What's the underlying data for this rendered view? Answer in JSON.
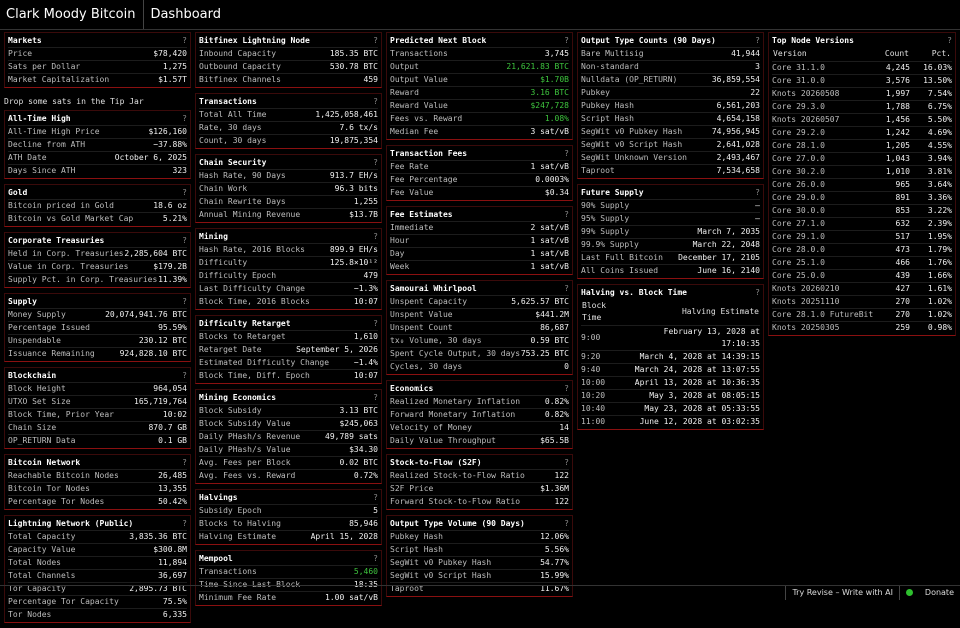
{
  "header": {
    "title": "Clark Moody Bitcoin",
    "tab": "Dashboard"
  },
  "col1": [
    {
      "name": "markets",
      "title": "Markets",
      "rows": [
        [
          "Price",
          "$78,420"
        ],
        [
          "Sats per Dollar",
          "1,275"
        ],
        [
          "Market Capitalization",
          "$1.57T"
        ]
      ]
    },
    {
      "name": "tip-jar",
      "plain": "Drop some sats in the Tip Jar"
    },
    {
      "name": "all-time-high",
      "title": "All-Time High",
      "rows": [
        [
          "All-Time High Price",
          "$126,160"
        ],
        [
          "Decline from ATH",
          "−37.88%"
        ],
        [
          "ATH Date",
          "October 6, 2025"
        ],
        [
          "Days Since ATH",
          "323"
        ]
      ]
    },
    {
      "name": "gold",
      "title": "Gold",
      "rows": [
        [
          "Bitcoin priced in Gold",
          "18.6 oz"
        ],
        [
          "Bitcoin vs Gold Market Cap",
          "5.21%"
        ]
      ]
    },
    {
      "name": "corporate-treasuries",
      "title": "Corporate Treasuries",
      "rows": [
        [
          "Held in Corp. Treasuries",
          "2,285,604 BTC"
        ],
        [
          "Value in Corp. Treasuries",
          "$179.2B"
        ],
        [
          "Supply Pct. in Corp. Treasuries",
          "11.39%"
        ]
      ]
    },
    {
      "name": "supply",
      "title": "Supply",
      "rows": [
        [
          "Money Supply",
          "20,074,941.76 BTC"
        ],
        [
          "Percentage Issued",
          "95.59%"
        ],
        [
          "Unspendable",
          "230.12 BTC"
        ],
        [
          "Issuance Remaining",
          "924,828.10 BTC"
        ]
      ]
    },
    {
      "name": "blockchain",
      "title": "Blockchain",
      "rows": [
        [
          "Block Height",
          "964,054"
        ],
        [
          "UTXO Set Size",
          "165,719,764"
        ],
        [
          "Block Time, Prior Year",
          "10:02"
        ],
        [
          "Chain Size",
          "870.7 GB"
        ],
        [
          "OP_RETURN Data",
          "0.1 GB"
        ]
      ]
    },
    {
      "name": "bitcoin-network",
      "title": "Bitcoin Network",
      "rows": [
        [
          "Reachable Bitcoin Nodes",
          "26,485"
        ],
        [
          "Bitcoin Tor Nodes",
          "13,355"
        ],
        [
          "Percentage Tor Nodes",
          "50.42%"
        ]
      ]
    },
    {
      "name": "lightning-network",
      "title": "Lightning Network (Public)",
      "rows": [
        [
          "Total Capacity",
          "3,835.36 BTC"
        ],
        [
          "Capacity Value",
          "$300.8M"
        ],
        [
          "Total Nodes",
          "11,894"
        ],
        [
          "Total Channels",
          "36,697"
        ],
        [
          "Tor Capacity",
          "2,895.73 BTC"
        ],
        [
          "Percentage Tor Capacity",
          "75.5%"
        ],
        [
          "Tor Nodes",
          "6,335"
        ]
      ]
    }
  ],
  "col2": [
    {
      "name": "bitfinex-lightning",
      "title": "Bitfinex Lightning Node",
      "rows": [
        [
          "Inbound Capacity",
          "185.35 BTC"
        ],
        [
          "Outbound Capacity",
          "530.78 BTC"
        ],
        [
          "Bitfinex Channels",
          "459"
        ]
      ]
    },
    {
      "name": "transactions",
      "title": "Transactions",
      "rows": [
        [
          "Total All Time",
          "1,425,058,461"
        ],
        [
          "Rate, 30 days",
          "7.6 tx/s"
        ],
        [
          "Count, 30 days",
          "19,875,354"
        ]
      ]
    },
    {
      "name": "chain-security",
      "title": "Chain Security",
      "rows": [
        [
          "Hash Rate, 90 Days",
          "913.7 EH/s"
        ],
        [
          "Chain Work",
          "96.3 bits"
        ],
        [
          "Chain Rewrite Days",
          "1,255"
        ],
        [
          "Annual Mining Revenue",
          "$13.7B"
        ]
      ]
    },
    {
      "name": "mining",
      "title": "Mining",
      "rows": [
        [
          "Hash Rate, 2016 Blocks",
          "899.9 EH/s"
        ],
        [
          "Difficulty",
          "125.8×10¹²"
        ],
        [
          "Difficulty Epoch",
          "479"
        ],
        [
          "Last Difficulty Change",
          "−1.3%"
        ],
        [
          "Block Time, 2016 Blocks",
          "10:07"
        ]
      ]
    },
    {
      "name": "difficulty-retarget",
      "title": "Difficulty Retarget",
      "rows": [
        [
          "Blocks to Retarget",
          "1,610"
        ],
        [
          "Retarget Date",
          "September 5, 2026"
        ],
        [
          "Estimated Difficulty Change",
          "−1.4%"
        ],
        [
          "Block Time, Diff. Epoch",
          "10:07"
        ]
      ]
    },
    {
      "name": "mining-economics",
      "title": "Mining Economics",
      "rows": [
        [
          "Block Subsidy",
          "3.13 BTC"
        ],
        [
          "Block Subsidy Value",
          "$245,063"
        ],
        [
          "Daily PHash/s Revenue",
          "49,789 sats"
        ],
        [
          "Daily PHash/s Value",
          "$34.30"
        ],
        [
          "Avg. Fees per Block",
          "0.02 BTC"
        ],
        [
          "Avg. Fees vs. Reward",
          "0.72%"
        ]
      ]
    },
    {
      "name": "halvings",
      "title": "Halvings",
      "rows": [
        [
          "Subsidy Epoch",
          "5"
        ],
        [
          "Blocks to Halving",
          "85,946"
        ],
        [
          "Halving Estimate",
          "April 15, 2028"
        ]
      ]
    },
    {
      "name": "mempool",
      "title": "Mempool",
      "rows": [
        [
          "Transactions",
          "5,460",
          "green"
        ],
        [
          "Time Since Last Block",
          "18:35"
        ],
        [
          "Minimum Fee Rate",
          "1.00 sat/vB"
        ]
      ]
    }
  ],
  "col3": [
    {
      "name": "predicted-next-block",
      "title": "Predicted Next Block",
      "rows": [
        [
          "Transactions",
          "3,745"
        ],
        [
          "Output",
          "21,621.83 BTC",
          "green"
        ],
        [
          "Output Value",
          "$1.70B",
          "green"
        ],
        [
          "Reward",
          "3.16 BTC",
          "green"
        ],
        [
          "Reward Value",
          "$247,728",
          "green"
        ],
        [
          "Fees vs. Reward",
          "1.08%",
          "green"
        ],
        [
          "Median Fee",
          "3 sat/vB"
        ]
      ]
    },
    {
      "name": "transaction-fees",
      "title": "Transaction Fees",
      "rows": [
        [
          "Fee Rate",
          "1 sat/vB"
        ],
        [
          "Fee Percentage",
          "0.0003%"
        ],
        [
          "Fee Value",
          "$0.34"
        ]
      ]
    },
    {
      "name": "fee-estimates",
      "title": "Fee Estimates",
      "rows": [
        [
          "Immediate",
          "2 sat/vB"
        ],
        [
          "Hour",
          "1 sat/vB"
        ],
        [
          "Day",
          "1 sat/vB"
        ],
        [
          "Week",
          "1 sat/vB"
        ]
      ]
    },
    {
      "name": "samourai-whirlpool",
      "title": "Samourai Whirlpool",
      "rows": [
        [
          "Unspent Capacity",
          "5,625.57 BTC"
        ],
        [
          "Unspent Value",
          "$441.2M"
        ],
        [
          "Unspent Count",
          "86,687"
        ],
        [
          "tx₀ Volume, 30 days",
          "0.59 BTC"
        ],
        [
          "Spent Cycle Output, 30 days",
          "753.25 BTC"
        ],
        [
          "Cycles, 30 days",
          "0"
        ]
      ]
    },
    {
      "name": "economics",
      "title": "Economics",
      "rows": [
        [
          "Realized Monetary Inflation",
          "0.82%"
        ],
        [
          "Forward Monetary Inflation",
          "0.82%"
        ],
        [
          "Velocity of Money",
          "14"
        ],
        [
          "Daily Value Throughput",
          "$65.5B"
        ]
      ]
    },
    {
      "name": "stock-to-flow",
      "title": "Stock-to-Flow (S2F)",
      "rows": [
        [
          "Realized Stock-to-Flow Ratio",
          "122"
        ],
        [
          "S2F Price",
          "$1.36M"
        ],
        [
          "Forward Stock-to-Flow Ratio",
          "122"
        ]
      ]
    },
    {
      "name": "output-type-volume",
      "title": "Output Type Volume (90 Days)",
      "rows": [
        [
          "Pubkey Hash",
          "12.06%"
        ],
        [
          "Script Hash",
          "5.56%"
        ],
        [
          "SegWit v0 Pubkey Hash",
          "54.77%"
        ],
        [
          "SegWit v0 Script Hash",
          "15.99%"
        ],
        [
          "Taproot",
          "11.67%"
        ]
      ]
    }
  ],
  "col4": [
    {
      "name": "output-type-counts",
      "title": "Output Type Counts (90 Days)",
      "rows": [
        [
          "Bare Multisig",
          "41,944"
        ],
        [
          "Non-standard",
          "3"
        ],
        [
          "Nulldata (OP_RETURN)",
          "36,859,554"
        ],
        [
          "Pubkey",
          "22"
        ],
        [
          "Pubkey Hash",
          "6,561,203"
        ],
        [
          "Script Hash",
          "4,654,158"
        ],
        [
          "SegWit v0 Pubkey Hash",
          "74,956,945"
        ],
        [
          "SegWit v0 Script Hash",
          "2,641,028"
        ],
        [
          "SegWit Unknown Version",
          "2,493,467"
        ],
        [
          "Taproot",
          "7,534,658"
        ]
      ]
    },
    {
      "name": "future-supply",
      "title": "Future Supply",
      "rows": [
        [
          "90% Supply",
          "—"
        ],
        [
          "95% Supply",
          "—"
        ],
        [
          "99% Supply",
          "March 7, 2035"
        ],
        [
          "99.9% Supply",
          "March 22, 2048"
        ],
        [
          "Last Full Bitcoin",
          "December 17, 2105"
        ],
        [
          "All Coins Issued",
          "June 16, 2140"
        ]
      ]
    }
  ],
  "halving_vs_block_time": {
    "title": "Halving vs. Block Time",
    "headers": [
      "Block Time",
      "Halving Estimate"
    ],
    "rows": [
      [
        "9:00",
        "February 13, 2028 at 17:10:35"
      ],
      [
        "9:20",
        "March 4, 2028 at 14:39:15"
      ],
      [
        "9:40",
        "March 24, 2028 at 13:07:55"
      ],
      [
        "10:00",
        "April 13, 2028 at 10:36:35"
      ],
      [
        "10:20",
        "May 3, 2028 at 08:05:15"
      ],
      [
        "10:40",
        "May 23, 2028 at 05:33:55"
      ],
      [
        "11:00",
        "June 12, 2028 at 03:02:35"
      ]
    ]
  },
  "node_versions": {
    "title": "Top Node Versions",
    "headers": [
      "Version",
      "Count",
      "Pct."
    ],
    "rows": [
      [
        "Core 31.1.0",
        "4,245",
        "16.03%"
      ],
      [
        "Core 31.0.0",
        "3,576",
        "13.50%"
      ],
      [
        "Knots 20260508",
        "1,997",
        "7.54%"
      ],
      [
        "Core 29.3.0",
        "1,788",
        "6.75%"
      ],
      [
        "Knots 20260507",
        "1,456",
        "5.50%"
      ],
      [
        "Core 29.2.0",
        "1,242",
        "4.69%"
      ],
      [
        "Core 28.1.0",
        "1,205",
        "4.55%"
      ],
      [
        "Core 27.0.0",
        "1,043",
        "3.94%"
      ],
      [
        "Core 30.2.0",
        "1,010",
        "3.81%"
      ],
      [
        "Core 26.0.0",
        "965",
        "3.64%"
      ],
      [
        "Core 29.0.0",
        "891",
        "3.36%"
      ],
      [
        "Core 30.0.0",
        "853",
        "3.22%"
      ],
      [
        "Core 27.1.0",
        "632",
        "2.39%"
      ],
      [
        "Core 29.1.0",
        "517",
        "1.95%"
      ],
      [
        "Core 28.0.0",
        "473",
        "1.79%"
      ],
      [
        "Core 25.1.0",
        "466",
        "1.76%"
      ],
      [
        "Core 25.0.0",
        "439",
        "1.66%"
      ],
      [
        "Knots 20260210",
        "427",
        "1.61%"
      ],
      [
        "Knots 20251110",
        "270",
        "1.02%"
      ],
      [
        "Core 28.1.0 FutureBit",
        "270",
        "1.02%"
      ],
      [
        "Knots 20250305",
        "259",
        "0.98%"
      ]
    ]
  },
  "help_glyph": "?",
  "footer": {
    "revise": "Try Revise – Write with AI",
    "donate": "Donate"
  },
  "colors": {
    "accent_border": "#8a1010",
    "green": "#3ec43e",
    "status_dot": "#2ec02e"
  }
}
